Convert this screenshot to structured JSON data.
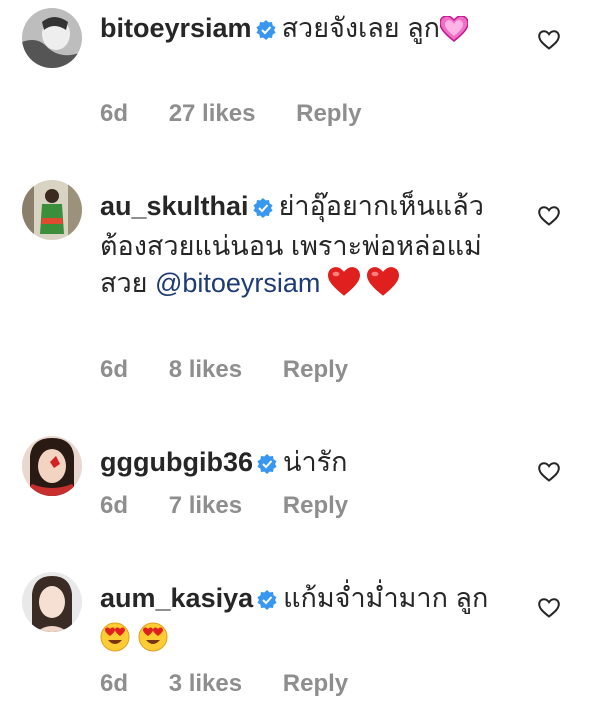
{
  "comments": [
    {
      "username": "bitoeyrsiam",
      "text": "สวยจังเลย ลูก",
      "time": "6d",
      "likes": "27 likes",
      "reply": "Reply"
    },
    {
      "username": "au_skulthai",
      "text": "ย่าอุ๊อยากเห็นแล้ว ต้องสวยแน่นอน เพราะพ่อหล่อแม่สวย ",
      "mention": "@bitoeyrsiam",
      "time": "6d",
      "likes": "8 likes",
      "reply": "Reply"
    },
    {
      "username": "gggubgib36",
      "text": "น่ารัก",
      "time": "6d",
      "likes": "7 likes",
      "reply": "Reply"
    },
    {
      "username": "aum_kasiya",
      "text": "แก้มจ่ำม่ำมาก ลูก",
      "time": "6d",
      "likes": "3 likes",
      "reply": "Reply"
    }
  ],
  "icons": {
    "verified": "verified-badge-icon",
    "like": "heart-outline-icon",
    "colors": {
      "verified": "#3897f0",
      "muted": "#8e8e8e",
      "mention": "#1f3b73"
    }
  }
}
